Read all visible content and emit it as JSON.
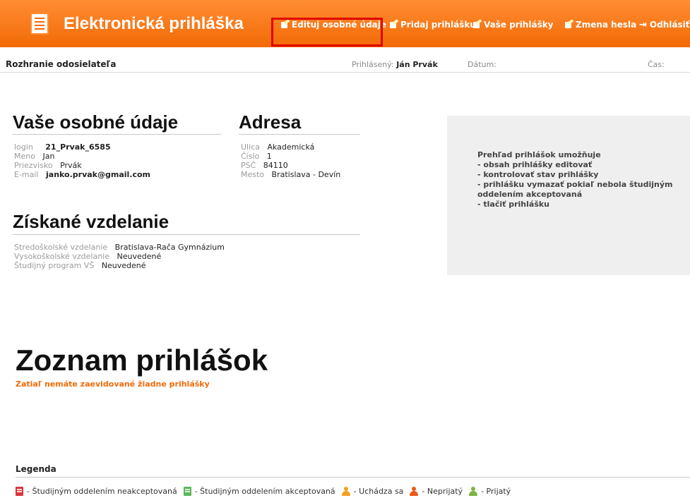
{
  "header": {
    "app_title": "Elektronická prihláška",
    "nav": [
      {
        "label": "Edituj osobné údaje",
        "icon": "edit-icon"
      },
      {
        "label": "Pridaj prihlášku",
        "icon": "add-document-icon"
      },
      {
        "label": "Vaše prihlášky",
        "icon": "documents-icon"
      },
      {
        "label": "Zmena hesla",
        "icon": "edit-password-icon"
      },
      {
        "label": "Odhlásiť",
        "icon": "logout-icon"
      }
    ]
  },
  "subbar": {
    "section": "Rozhranie odosielateľa",
    "logged_label": "Prihlásený:",
    "logged_user": "Ján Prvák",
    "date_label": "Dátum:",
    "time_label": "Čas:"
  },
  "personal": {
    "title": "Vaše osobné údaje",
    "fields": [
      {
        "label": "login",
        "value": "21_Prvak_6585"
      },
      {
        "label": "Meno",
        "value": "Jan"
      },
      {
        "label": "Priezvisko",
        "value": "Prvák"
      },
      {
        "label": "E-mail",
        "value": "janko.prvak@gmail.com"
      }
    ]
  },
  "address": {
    "title": "Adresa",
    "fields": [
      {
        "label": "Ulica",
        "value": "Akademická"
      },
      {
        "label": "Číslo",
        "value": "1"
      },
      {
        "label": "PSČ",
        "value": "84110"
      },
      {
        "label": "Mesto",
        "value": "Bratislava - Devín"
      }
    ]
  },
  "education": {
    "title": "Získané vzdelanie",
    "fields": [
      {
        "label": "Stredoškolské vzdelanie",
        "value": "Bratislava-Rača Gymnázium"
      },
      {
        "label": "Vysokoškolské vzdelanie",
        "value": "Neuvedené"
      },
      {
        "label": "Študijný program VŠ",
        "value": "Neuvedené"
      }
    ]
  },
  "info_panel": {
    "lines": [
      "Prehľad prihlášok umožňuje",
      "- obsah prihlášky editovať",
      "- kontrolovať stav prihlášky",
      "- prihlášku vymazať pokiaľ nebola študijným",
      "oddelením akceptovaná",
      "- tlačiť prihlášku"
    ]
  },
  "applications": {
    "title": "Zoznam prihlášok",
    "empty_message": "Zatiaľ nemáte zaevidované žiadne prihlášky"
  },
  "legend": {
    "title": "Legenda",
    "items": [
      {
        "label": "- Študijným oddelením neakceptovaná",
        "icon": "red-document-icon",
        "color": "#d9363e"
      },
      {
        "label": "- Študijným oddelením akceptovaná",
        "icon": "green-document-icon",
        "color": "#5cb85c"
      },
      {
        "label": "- Uchádza sa",
        "icon": "orange-person-icon",
        "color": "#f0a020"
      },
      {
        "label": "- Neprijatý",
        "icon": "red-person-icon",
        "color": "#e85a1a"
      },
      {
        "label": "- Prijatý",
        "icon": "green-person-icon",
        "color": "#7cb342"
      }
    ]
  },
  "colors": {
    "accent": "#f26a06",
    "highlight": "#e10000"
  }
}
